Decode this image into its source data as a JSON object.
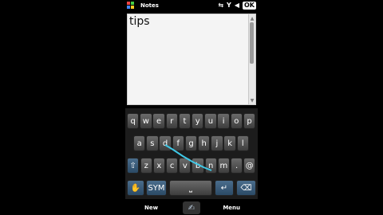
{
  "statusbar": {
    "title": "Notes",
    "ok": "OK",
    "icons": [
      "windows-flag-icon",
      "sync-icon",
      "signal-icon",
      "volume-icon"
    ]
  },
  "note": {
    "text": "tips"
  },
  "keyboard": {
    "row1": [
      "q",
      "w",
      "e",
      "r",
      "t",
      "y",
      "u",
      "i",
      "o",
      "p"
    ],
    "row2": [
      "a",
      "s",
      "d",
      "f",
      "g",
      "h",
      "j",
      "k",
      "l"
    ],
    "row3": [
      "z",
      "x",
      "c",
      "v",
      "b",
      "n",
      "m",
      ".",
      "@"
    ],
    "sym": "SYM",
    "caps_hint": "Caps"
  },
  "softkeys": {
    "left": "New",
    "right": "Menu"
  }
}
